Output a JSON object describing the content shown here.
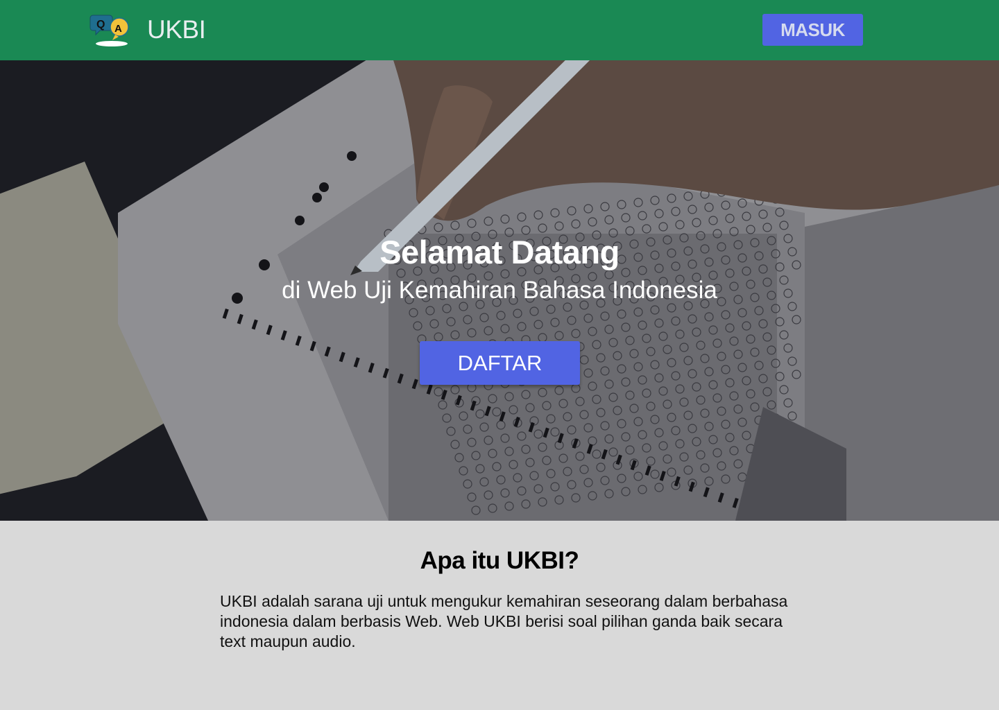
{
  "navbar": {
    "brand": "UKBI",
    "logo_icon": "qa-chat-bubbles-icon",
    "logo_letters": {
      "q": "Q",
      "a": "A"
    },
    "login_label": "MASUK",
    "colors": {
      "bar": "#1a8954",
      "button": "#5164e3"
    }
  },
  "hero": {
    "title": "Selamat Datang",
    "subtitle": "di Web Uji Kemahiran Bahasa Indonesia",
    "register_label": "DAFTAR",
    "background": "answer-sheet-pencil-photo"
  },
  "about": {
    "heading": "Apa itu UKBI?",
    "body": "UKBI adalah sarana uji untuk mengukur kemahiran seseorang dalam berbahasa indonesia dalam berbasis Web. Web UKBI berisi soal pilihan ganda baik secara text maupun audio."
  }
}
